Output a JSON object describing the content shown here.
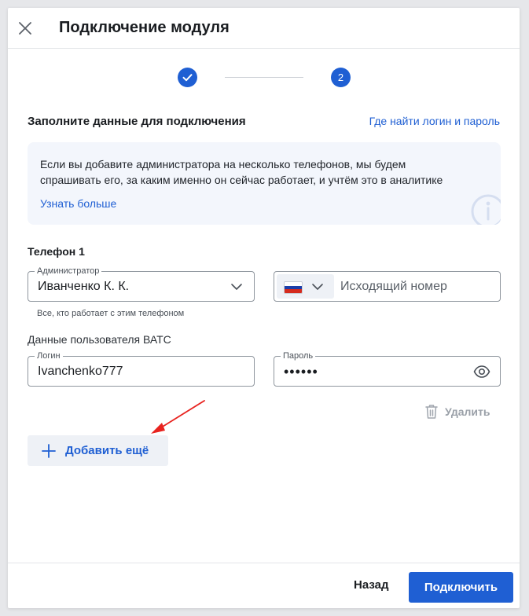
{
  "modal": {
    "title": "Подключение модуля",
    "steps": [
      {
        "state": "done",
        "label": ""
      },
      {
        "state": "active",
        "label": "2"
      }
    ]
  },
  "form": {
    "section_title": "Заполните данные для подключения",
    "help_link": "Где найти логин и пароль",
    "info": {
      "text": "Если вы добавите администратора на несколько телефонов, мы будем спрашивать его, за каким именно он сейчас работает, и учтём это в аналитике",
      "link": "Узнать больше",
      "icon": "info-icon"
    },
    "phone_block_title": "Телефон 1",
    "admin": {
      "label": "Администратор",
      "value": "Иванченко К. К.",
      "hint": "Все, кто работает с этим телефоном"
    },
    "phone": {
      "country": "ru",
      "placeholder": "Исходящий номер"
    },
    "vats_title": "Данные пользователя ВАТС",
    "login": {
      "label": "Логин",
      "value": "Ivanchenko777"
    },
    "password": {
      "label": "Пароль",
      "masked_value": "••••••"
    },
    "delete_label": "Удалить",
    "add_more_label": "Добавить ещё"
  },
  "footer": {
    "back_label": "Назад",
    "connect_label": "Подключить"
  },
  "colors": {
    "accent": "#1f5fd3",
    "info_bg": "#f3f6fc",
    "annotation_arrow": "#e8231f"
  }
}
